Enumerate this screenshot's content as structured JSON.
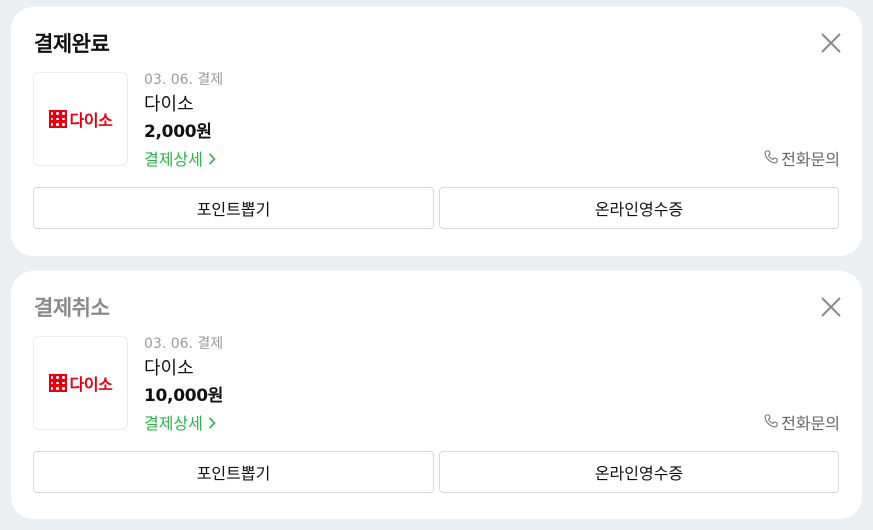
{
  "orders": [
    {
      "status": "결제완료",
      "date_label": "03. 06. 결제",
      "merchant": "다이소",
      "amount": "2,000원",
      "detail_link": "결제상세",
      "phone_label": "전화문의",
      "btn_points": "포인트뽑기",
      "btn_receipt": "온라인영수증",
      "logo_text": "다이소"
    },
    {
      "status": "결제취소",
      "date_label": "03. 06. 결제",
      "merchant": "다이소",
      "amount": "10,000원",
      "detail_link": "결제상세",
      "phone_label": "전화문의",
      "btn_points": "포인트뽑기",
      "btn_receipt": "온라인영수증",
      "logo_text": "다이소"
    }
  ],
  "icons": {
    "close": "close-icon",
    "phone": "phone-icon",
    "chevron": "chevron-right-icon",
    "logo": "daiso-logo"
  },
  "colors": {
    "accent_green": "#2db44a",
    "brand_red": "#e60012",
    "background": "#eceeef"
  }
}
